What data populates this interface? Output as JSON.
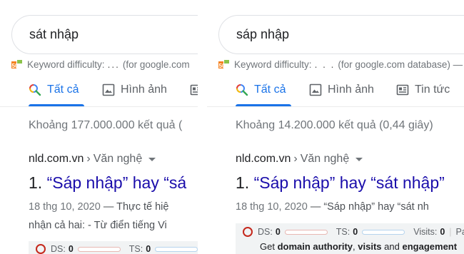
{
  "left": {
    "query": "sát nhập",
    "keyword": {
      "label": "Keyword difficulty:",
      "dots": "...",
      "suffix": "(for google.com"
    },
    "tabs": [
      {
        "label": "Tất cả"
      },
      {
        "label": "Hình ảnh"
      }
    ],
    "stats": "Khoảng 177.000.000 kết quả (",
    "result": {
      "site": "nld.com.vn",
      "sep": "›",
      "path": "Văn nghệ",
      "num": "1.",
      "title": "“Sáp nhập” hay “sá",
      "date": "18 thg 10, 2020",
      "snippet1": " — Thực tế hiệ",
      "snippet2": "nhận cả hai: - Từ điển tiếng Vi"
    },
    "seo": {
      "ds_label": "DS:",
      "ds_val": "0",
      "ts_label": "TS:",
      "ts_val": "0"
    }
  },
  "right": {
    "query": "sáp nhập",
    "keyword": {
      "label": "Keyword difficulty:",
      "dots": ". . .",
      "suffix": "(for google.com database) —"
    },
    "tabs": [
      {
        "label": "Tất cả"
      },
      {
        "label": "Hình ảnh"
      },
      {
        "label": "Tin tức"
      }
    ],
    "stats": "Khoảng 14.200.000 kết quả (0,44 giây)",
    "result": {
      "site": "nld.com.vn",
      "sep": "›",
      "path": "Văn nghệ",
      "num": "1.",
      "title": "“Sáp nhập” hay “sát nhập”",
      "date": "18 thg 10, 2020",
      "snippet1": " — “Sáp nhập” hay “sát nh"
    },
    "seo": {
      "ds_label": "DS:",
      "ds_val": "0",
      "ts_label": "TS:",
      "ts_val": "0",
      "visits_label": "Visits:",
      "visits_val": "0",
      "pa_label": "Pa",
      "get": "Get",
      "domain_authority": "domain authority",
      "comma": ",",
      "visits": "visits",
      "and": "and",
      "engagement": "engagement"
    }
  },
  "colors": {
    "accent": "#1a73e8",
    "link": "#1a0dab",
    "semrush": "#f58220"
  }
}
